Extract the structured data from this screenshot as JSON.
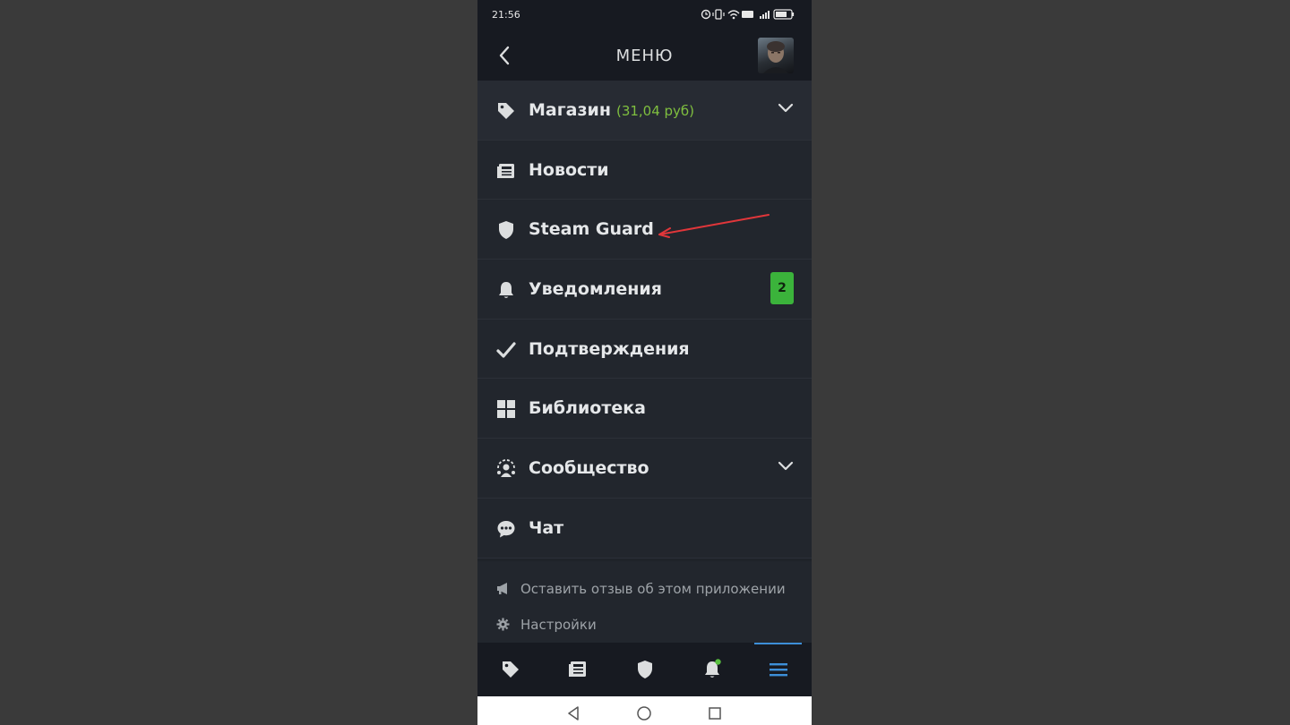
{
  "status_bar": {
    "time": "21:56",
    "battery": "62"
  },
  "header": {
    "title": "МЕНЮ",
    "back_icon": "chevron-left-icon",
    "avatar": "user-avatar"
  },
  "menu": {
    "items": [
      {
        "label": "Магазин",
        "balance": "(31,04 руб)",
        "icon": "tag-icon",
        "expandable": true
      },
      {
        "label": "Новости",
        "icon": "newspaper-icon"
      },
      {
        "label": "Steam Guard",
        "icon": "shield-icon"
      },
      {
        "label": "Уведомления",
        "icon": "bell-icon",
        "badge": "2"
      },
      {
        "label": "Подтверждения",
        "icon": "checkmark-icon"
      },
      {
        "label": "Библиотека",
        "icon": "grid-icon"
      },
      {
        "label": "Сообщество",
        "icon": "community-icon",
        "expandable": true
      },
      {
        "label": "Чат",
        "icon": "chat-icon"
      }
    ]
  },
  "footer_links": [
    {
      "label": "Оставить отзыв об этом приложении",
      "icon": "megaphone-icon"
    },
    {
      "label": "Настройки",
      "icon": "gear-icon"
    }
  ],
  "bottom_nav": {
    "items": [
      "tag-icon",
      "newspaper-icon",
      "shield-icon",
      "bell-icon",
      "menu-icon"
    ],
    "active": "menu-icon"
  },
  "colors": {
    "background": "#3a3a3a",
    "panel": "#22262d",
    "header": "#171a21",
    "accent_green": "#7fbf3f",
    "badge_green": "#3bb33b",
    "active_blue": "#3d8fd8",
    "annotation_red": "#e0363a"
  }
}
